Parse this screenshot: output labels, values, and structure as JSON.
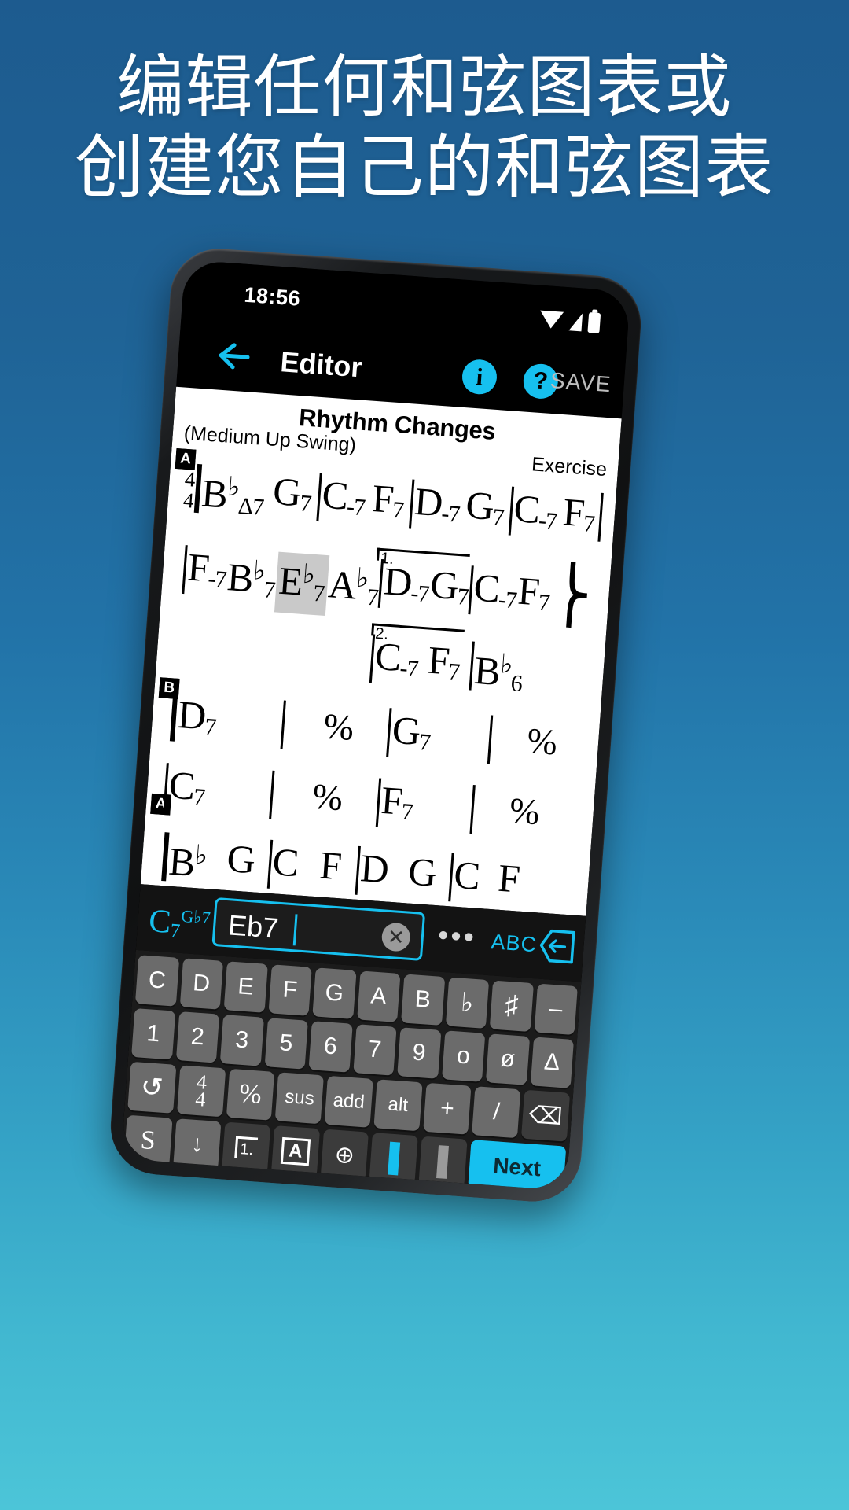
{
  "promo": {
    "line1": "编辑任何和弦图表或",
    "line2": "创建您自己的和弦图表",
    "background_top": "#1d5b8f",
    "background_bottom": "#4cc5d8"
  },
  "statusbar": {
    "time": "18:56",
    "icons": [
      "wifi-icon",
      "signal-icon",
      "battery-icon"
    ]
  },
  "appbar": {
    "back_icon": "back-arrow-icon",
    "title": "Editor",
    "info_label": "i",
    "help_label": "?",
    "save_label": "SAVE",
    "accent": "#16c0ef"
  },
  "chart": {
    "title": "Rhythm Changes",
    "tempo": "(Medium Up Swing)",
    "exercise": "Exercise",
    "timesig_top": "4",
    "timesig_bottom": "4",
    "sections": [
      {
        "label": "A",
        "row": 1
      },
      {
        "label": "B",
        "row": 4
      },
      {
        "label": "A",
        "row": 6
      }
    ],
    "repeat_labels": [
      "1.",
      "2."
    ],
    "rows": [
      {
        "id": "row-1",
        "cells": [
          {
            "chord": "B",
            "flat": true,
            "sub": "Δ7"
          },
          {
            "chord": "G",
            "sub": "7"
          },
          {
            "chord": "C",
            "sub": "-7",
            "barbefore": true
          },
          {
            "chord": "F",
            "sub": "7"
          },
          {
            "chord": "D",
            "sub": "-7",
            "barbefore": true
          },
          {
            "chord": "G",
            "sub": "7"
          },
          {
            "chord": "C",
            "sub": "-7",
            "barbefore": true
          },
          {
            "chord": "F",
            "sub": "7"
          }
        ]
      },
      {
        "id": "row-2",
        "cells": [
          {
            "chord": "F",
            "sub": "-7",
            "barbefore": true
          },
          {
            "chord": "B",
            "flat": true,
            "sub": "7"
          },
          {
            "chord": "E",
            "flat": true,
            "sub": "7",
            "selected": true
          },
          {
            "chord": "A",
            "flat": true,
            "sub": "7"
          },
          {
            "chord": "D",
            "sub": "-7",
            "barbefore": true
          },
          {
            "chord": "G",
            "sub": "7"
          },
          {
            "chord": "C",
            "sub": "-7",
            "barbefore": true
          },
          {
            "chord": "F",
            "sub": "7"
          }
        ]
      },
      {
        "id": "row-3",
        "cells": [
          {
            "chord": "C",
            "sub": "-7",
            "barbefore": true
          },
          {
            "chord": "F",
            "sub": "7"
          },
          {
            "chord": "B",
            "flat": true,
            "sub": "6",
            "barbefore": true
          }
        ]
      },
      {
        "id": "row-4",
        "cells": [
          {
            "chord": "D",
            "sub": "7",
            "barbefore": true
          },
          {
            "repeat": "%"
          },
          {
            "chord": "G",
            "sub": "7",
            "barbefore": true
          },
          {
            "repeat": "%"
          }
        ]
      },
      {
        "id": "row-5",
        "cells": [
          {
            "chord": "C",
            "sub": "7",
            "barbefore": true
          },
          {
            "repeat": "%"
          },
          {
            "chord": "F",
            "sub": "7",
            "barbefore": true
          },
          {
            "repeat": "%"
          }
        ]
      },
      {
        "id": "row-6",
        "cells": [
          {
            "chord": "B",
            "flat": true,
            "sub": ""
          },
          {
            "chord": "G",
            "sub": ""
          },
          {
            "chord": "C",
            "sub": ""
          },
          {
            "chord": "F",
            "sub": ""
          },
          {
            "chord": "D",
            "sub": ""
          },
          {
            "chord": "G",
            "sub": ""
          },
          {
            "chord": "C",
            "sub": ""
          },
          {
            "chord": "F",
            "sub": ""
          }
        ]
      }
    ]
  },
  "input": {
    "preview_root": "C",
    "preview_sub": "7",
    "preview_sup": "G♭7",
    "value": "Eb7",
    "placeholder": "",
    "clear_icon": "clear-x-icon",
    "more_label": "•••",
    "abc_label": "ABC",
    "left_icon": "arrow-left-hex-icon",
    "plus_icon": "plus-hex-icon"
  },
  "keyboard": {
    "rows": [
      {
        "id": "kb-row-1",
        "keys": [
          {
            "label": "C"
          },
          {
            "label": "D"
          },
          {
            "label": "E"
          },
          {
            "label": "F"
          },
          {
            "label": "G"
          },
          {
            "label": "A"
          },
          {
            "label": "B"
          },
          {
            "label": "♭",
            "serif": true
          },
          {
            "label": "♯",
            "serif": true
          },
          {
            "label": "–"
          }
        ]
      },
      {
        "id": "kb-row-2",
        "keys": [
          {
            "label": "1"
          },
          {
            "label": "2"
          },
          {
            "label": "3"
          },
          {
            "label": "5"
          },
          {
            "label": "6"
          },
          {
            "label": "7"
          },
          {
            "label": "9"
          },
          {
            "label": "o"
          },
          {
            "label": "ø"
          },
          {
            "label": "Δ"
          }
        ]
      },
      {
        "id": "kb-row-3",
        "keys": [
          {
            "label": "↺",
            "name": "undo-key"
          },
          {
            "label": "4/4",
            "name": "timesig-key",
            "stack": true
          },
          {
            "label": "%",
            "name": "repeat-key",
            "serif": true
          },
          {
            "label": "sus",
            "small": true
          },
          {
            "label": "add",
            "small": true
          },
          {
            "label": "alt",
            "small": true
          },
          {
            "label": "+"
          },
          {
            "label": "/"
          },
          {
            "label": "⌫",
            "name": "backspace-key",
            "dark": true
          }
        ]
      },
      {
        "id": "kb-row-4",
        "keys": [
          {
            "label": "S",
            "name": "segno-key"
          },
          {
            "label": "↓",
            "name": "coda-key"
          },
          {
            "label": "1.",
            "name": "repeat-bracket-key",
            "dark": true
          },
          {
            "label": "A",
            "name": "section-letter-key",
            "dark": true
          },
          {
            "label": "⊕",
            "name": "coda-symbol-key",
            "dark": true
          },
          {
            "label": "",
            "name": "barline-open-key",
            "dark": true
          },
          {
            "label": "",
            "name": "barline-close-key",
            "dark": true
          },
          {
            "label": "Next",
            "name": "next-key",
            "next": true
          }
        ]
      }
    ]
  },
  "navbar": {
    "back_icon": "nav-back-triangle-icon",
    "home_icon": "nav-home-circle-icon",
    "recent_icon": "nav-recents-square-icon"
  }
}
